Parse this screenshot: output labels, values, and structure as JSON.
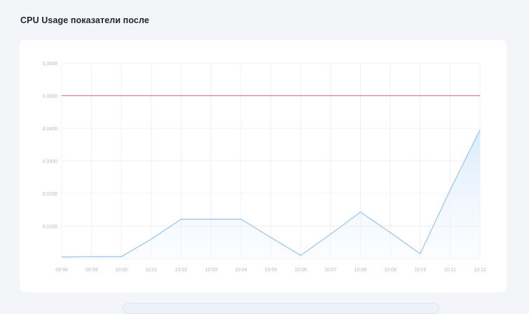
{
  "page": {
    "title": "CPU Usage показатели после"
  },
  "chart_data": {
    "type": "area",
    "x": [
      "09:58",
      "09:59",
      "10:00",
      "10:01",
      "10:02",
      "10:03",
      "10:04",
      "10:05",
      "10:06",
      "10:07",
      "10:08",
      "10:09",
      "10:10",
      "10:11",
      "10:12"
    ],
    "ylim": [
      0,
      0.06
    ],
    "yticks": [
      "0.0100",
      "0.0200",
      "0.0300",
      "0.0400",
      "0.0500",
      "0.0600"
    ],
    "ytick_values": [
      0.01,
      0.02,
      0.03,
      0.04,
      0.05,
      0.06
    ],
    "grid": true,
    "series": [
      {
        "values": [
          0.0005,
          0.0006,
          0.0006,
          0.006,
          0.0121,
          0.0121,
          0.0121,
          0.0065,
          0.001,
          0.0075,
          0.0143,
          0.008,
          0.0015,
          0.021,
          0.0395
        ],
        "color": "#9cc8ee",
        "fill": "#e6f1fc"
      }
    ],
    "threshold": {
      "value": 0.05,
      "color": "#e07a95"
    },
    "title": "",
    "xlabel": "",
    "ylabel": ""
  },
  "colors": {
    "background": "#f3f5f9",
    "card": "#ffffff",
    "grid": "#eef0f4",
    "tick_text": "#b3b8c3"
  }
}
